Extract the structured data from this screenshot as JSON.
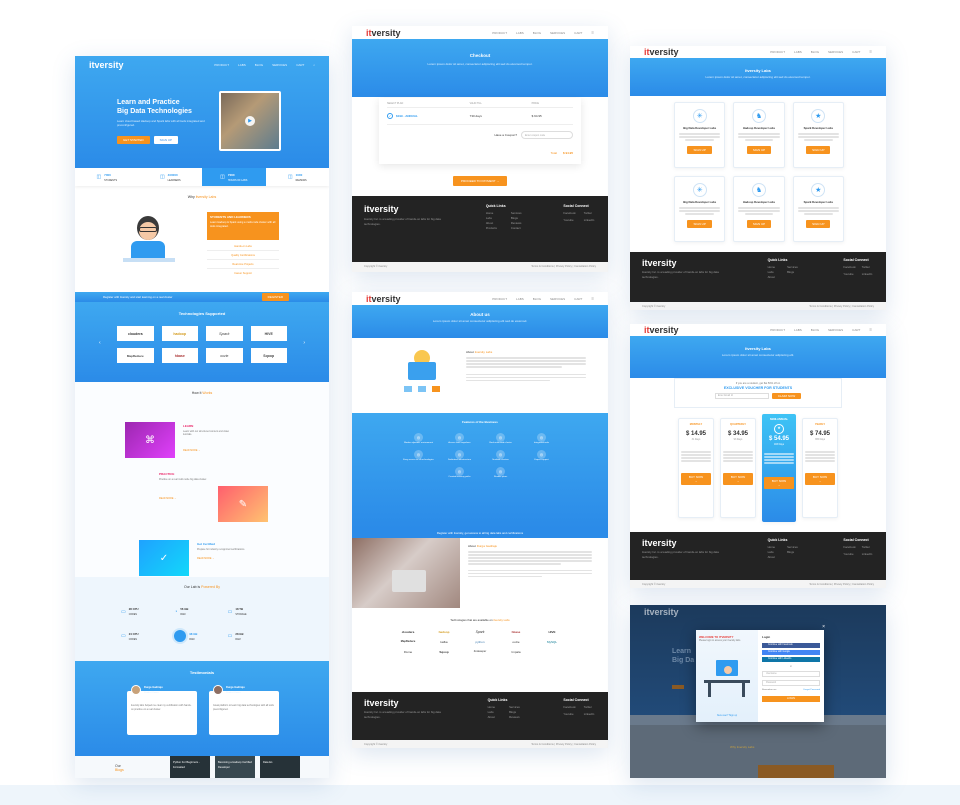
{
  "brand": {
    "logo_prefix": "it",
    "logo_suffix": "versity"
  },
  "nav": {
    "links": [
      "PRODUCT",
      "LABS",
      "BLOG",
      "SERVICES",
      "CART"
    ]
  },
  "home": {
    "hero_title_1": "Learn and Practice",
    "hero_title_2": "Big Data Technologies",
    "hero_text": "Learn cloud based Hadoop and Spark labs with all tools integrated and preconfigured.",
    "btn_primary": "GET STARTED",
    "btn_secondary": "SIGN UP",
    "stats": [
      {
        "num": "7000",
        "label": "STUDENTS"
      },
      {
        "num": "400000",
        "label": "LEARNERS"
      },
      {
        "num": "7000",
        "label": "HOURS OF LABS"
      },
      {
        "num": "1000",
        "label": "REVIEWS"
      }
    ],
    "why_prefix": "Why",
    "why_highlight": "itversity Labs",
    "why_box_title": "STUDENTS AND LEARNERS",
    "why_box_text": "Learn Hadoop & Spark using a multi-node cluster with all tools integrated.",
    "why_items": [
      "Hands-on Labs",
      "Quality Certifications",
      "Real-time Projects",
      "Career Support"
    ],
    "cta_text": "Register with itversity and start learning on a real cluster",
    "cta_button": "REGISTER",
    "tech_title": "Technologies Supported",
    "tech_logos": [
      "cloudera",
      "hadoop",
      "Spark",
      "HIVE",
      "MapReduce",
      "hbase",
      "oozie",
      "Sqoop"
    ],
    "how_prefix": "How it",
    "how_highlight": "Works",
    "steps": [
      {
        "title": "LEARN",
        "text": "Learn with our structured content and video tutorials.",
        "link": "READ MORE →"
      },
      {
        "title": "PRACTICE",
        "text": "Practice on a real multi-node big data cluster.",
        "link": "READ MORE →"
      },
      {
        "title": "Get Certified",
        "text": "Prepare for industry recognized certifications.",
        "link": "READ MORE →"
      }
    ],
    "lab_prefix": "Our Lab is",
    "lab_highlight": "Powered By",
    "lab_items": [
      {
        "num": "28 CPU",
        "label": "CORES"
      },
      {
        "num": "56 GB",
        "label": "RAM"
      },
      {
        "num": "18 TB",
        "label": "STORAGE"
      },
      {
        "num": "24 CPU",
        "label": "CORES"
      },
      {
        "num": "98 GB",
        "label": "RAM"
      },
      {
        "num": "28 GB",
        "label": "RAM"
      }
    ],
    "testimonials_title": "Testimonials",
    "testimonials": [
      {
        "name": "Durga Gadiraju",
        "role": "Product Owner",
        "quote": "itversity labs helped me clear my certification with hands-on practice on a real cluster."
      },
      {
        "name": "Durga Gadiraju",
        "role": "Product Owner",
        "quote": "Great platform to learn big data technologies with all tools preconfigured."
      }
    ],
    "blog_title_1": "Our",
    "blog_title_2": "Blogs",
    "blog_cards": [
      "Python For Beginners - Formatted",
      "Becoming a Hadoop Certified Developer",
      "Data En"
    ]
  },
  "checkout": {
    "title": "Checkout",
    "subtitle": "Lorem ipsum dolor sit amet, consectetur adipiscing elit sed do eiusmod tempor.",
    "col_plan": "SELECT PLAN",
    "col_valid": "VALID TILL",
    "col_price": "PRICE",
    "plan": "$199 - ANNUAL",
    "valid": "730 days",
    "price": "$ 94.95",
    "coupon_label": "Have a Coupon?",
    "coupon_placeholder": "Enter coupon code",
    "total_label": "Total",
    "total": "$ 94.95",
    "proceed_button": "PROCEED TO PAYMENT →"
  },
  "footer": {
    "about": "itversity Inc. is a leading provider of hands-on labs for big data technologies.",
    "quick_links_title": "Quick Links",
    "links_col1": [
      "Home",
      "Labs",
      "About",
      "Products"
    ],
    "links_col2": [
      "Services",
      "Blogs",
      "Reviews",
      "Contact"
    ],
    "social_title": "Social Connect",
    "social": [
      "Facebook",
      "Twitter",
      "Youtube",
      "LinkedIn"
    ],
    "copyright": "Copyright © itversity",
    "terms": "Terms & Conditions | Privacy Policy | Cancellation Policy"
  },
  "labs": {
    "title": "Itversity Labs",
    "subtitle": "Lorem ipsum dolor sit amet, consectetur adipiscing elit sed do eiusmod tempor.",
    "cards": [
      {
        "title": "Big Data Developer Labs",
        "button": "SIGN UP"
      },
      {
        "title": "Hadoop Developer Labs",
        "button": "SIGN UP"
      },
      {
        "title": "Spark Developer Labs",
        "button": "SIGN UP"
      },
      {
        "title": "Big Data Developer Labs",
        "button": "SIGN UP"
      },
      {
        "title": "Hadoop Developer Labs",
        "button": "SIGN UP"
      },
      {
        "title": "Spark Developer Labs",
        "button": "SIGN UP"
      }
    ]
  },
  "about": {
    "title": "About us",
    "subtitle": "Lorem ipsum dolor sit amet consectetur adipiscing elit sed do eiusmod.",
    "heading_prefix": "About",
    "heading_highlight": "itversity Labs",
    "features_title": "Features of the Business",
    "features": [
      "Modern dynamic environment",
      "Access from anywhere",
      "Real multi-node cluster",
      "Integrated tools",
      "Easy access to all technologies",
      "Dedicated infrastructure",
      "Scalable clusters",
      "Expert support",
      "Curated learning paths",
      "Flexible plans"
    ],
    "ribbon": "Register with itversity, get access to all big data labs and certifications",
    "who_prefix": "About",
    "who_highlight": "Durga Gadiraju",
    "tech_prefix": "Technologies that are available on",
    "tech_highlight": "itversity Labs",
    "tech_logos": [
      "cloudera",
      "hadoop",
      "Spark",
      "hbase",
      "HIVE",
      "MapReduce",
      "kafka",
      "python",
      "oozie",
      "MySQL",
      "Flume",
      "Sqoop",
      "Zookeeper",
      "Impala"
    ]
  },
  "pricing": {
    "title": "Itversity Labs",
    "subtitle": "Lorem ipsum dolor sit amet consectetur adipiscing elit.",
    "voucher_line": "If you are a student, get flat 50% off on",
    "voucher_title": "EXCLUSIVE VOUCHER FOR STUDENTS",
    "voucher_placeholder": "Enter Email Id",
    "voucher_button": "CLAIM NOW",
    "plans": [
      {
        "name": "MONTHLY",
        "price": "$ 14.95",
        "period": "31 Days"
      },
      {
        "name": "QUARTERLY",
        "price": "$ 34.95",
        "period": "93 Days"
      },
      {
        "name": "SEMI-ANNUAL",
        "price": "$ 54.95",
        "period": "183 Days"
      },
      {
        "name": "YEARLY",
        "price": "$ 74.95",
        "period": "365 Days"
      }
    ],
    "plan_button": "BUY NOW →"
  },
  "login": {
    "welcome": "WELCOME TO ITVERSITY",
    "welcome_text": "Please login to access your itversity labs.",
    "new_user": "New user? Sign up",
    "title": "Login",
    "social_buttons": [
      "Continue with Facebook",
      "Continue with Google",
      "Continue with LinkedIn"
    ],
    "or": "or",
    "username_placeholder": "Username",
    "password_placeholder": "Password",
    "remember": "Remember me",
    "forgot": "Forgot Password",
    "submit": "LOGIN",
    "bg_title_1": "Learn",
    "bg_title_2": "Big Da",
    "bg_why": "Why itversity Labs"
  },
  "colors": {
    "accent": "#f7931e",
    "blue": "#2f9bf0",
    "dark": "#232323",
    "brand_red": "#e53935"
  }
}
